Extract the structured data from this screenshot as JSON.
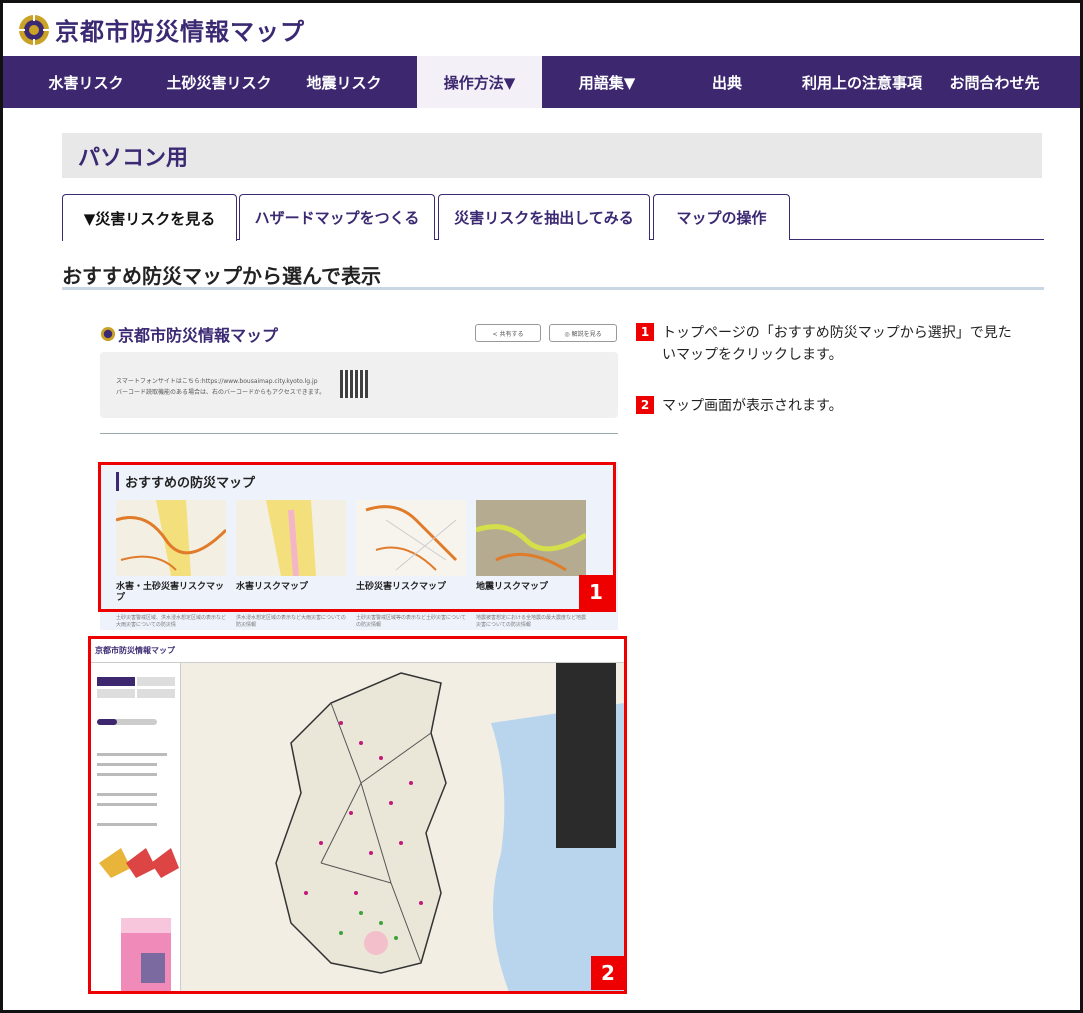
{
  "header": {
    "site_title": "京都市防災情報マップ"
  },
  "nav": [
    {
      "label": "水害リスク"
    },
    {
      "label": "土砂災害リスク"
    },
    {
      "label": "地震リスク"
    },
    {
      "label": "操作方法▼"
    },
    {
      "label": "用語集▼"
    },
    {
      "label": "出典"
    },
    {
      "label": "利用上の注意事項"
    },
    {
      "label": "お問合わせ先"
    }
  ],
  "section": {
    "title": "パソコン用"
  },
  "tabs": [
    {
      "label": "▼災害リスクを見る"
    },
    {
      "label": "ハザードマップをつくる"
    },
    {
      "label": "災害リスクを抽出してみる"
    },
    {
      "label": "マップの操作"
    }
  ],
  "heading": "おすすめ防災マップから選んで表示",
  "screenshot1": {
    "site_title": "京都市防災情報マップ",
    "share_button": "< 共有する",
    "help_button": "◎ 解説を見る",
    "info_line1": "スマートフォンサイトはこちら:https://www.bousaimap.city.kyoto.lg.jp",
    "info_line2": "バーコード読取機能のある場合は、右のバーコードからもアクセスできます。",
    "rec_title": "おすすめの防災マップ",
    "maps": [
      {
        "label": "水害・土砂災害リスクマップ",
        "desc": "土砂災害警戒区域、洪水浸水想定区域の表示など大雨災害についての防災情"
      },
      {
        "label": "水害リスクマップ",
        "desc": "洪水浸水想定区域の表示など大雨災害についての防災情報"
      },
      {
        "label": "土砂災害リスクマップ",
        "desc": "土砂災害警戒区域等の表示など土砂災害についての防災情報"
      },
      {
        "label": "地震リスクマップ",
        "desc": "地震被害想定における全地震の最大震度など地震災害についての防災情報"
      }
    ]
  },
  "screenshot2": {
    "site_title": "京都市防災情報マップ"
  },
  "badges": {
    "one": "1",
    "two": "2"
  },
  "steps": [
    {
      "num": "1",
      "text": "トップページの「おすすめ防災マップから選択」で見たいマップをクリックします。"
    },
    {
      "num": "2",
      "text": "マップ画面が表示されます。"
    }
  ]
}
